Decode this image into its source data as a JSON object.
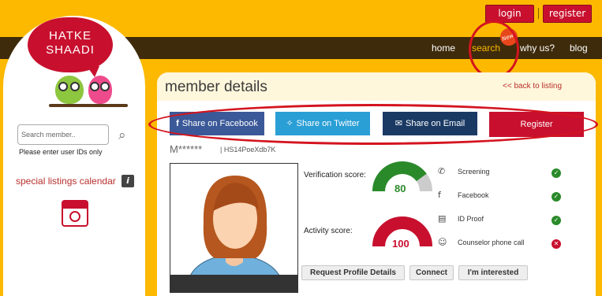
{
  "header": {
    "login": "login",
    "register": "register",
    "nav": [
      {
        "label": "home"
      },
      {
        "label": "search"
      },
      {
        "label": "why us?"
      },
      {
        "label": "blog"
      }
    ],
    "new_badge": "New!"
  },
  "logo": {
    "line1": "HATKE",
    "line2": "SHAADI"
  },
  "sidebar": {
    "search_placeholder": "Search member..",
    "hint": "Please enter user IDs only",
    "calendar_link": "special listings calendar",
    "info_glyph": "i"
  },
  "main": {
    "title": "member details",
    "back_link": "<< back to listing",
    "share": {
      "facebook": "Share on Facebook",
      "twitter": "Share on Twitter",
      "email": "Share on Email",
      "register": "Register"
    },
    "member_name": "M******",
    "member_id": "| HS14PoeXdb7K",
    "verification_label": "Verification score:",
    "verification_score": 80,
    "activity_label": "Activity score:",
    "activity_score": 100,
    "checks": [
      {
        "label": "Screening",
        "icon": "phone-icon",
        "status": "ok"
      },
      {
        "label": "Facebook",
        "icon": "facebook-icon",
        "status": "ok"
      },
      {
        "label": "ID Proof",
        "icon": "document-icon",
        "status": "ok"
      },
      {
        "label": "Counselor phone call",
        "icon": "counselor-icon",
        "status": "fail"
      }
    ],
    "actions": {
      "request": "Request Profile Details",
      "connect": "Connect",
      "interested": "I'm interested"
    }
  },
  "colors": {
    "background": "#fcb900",
    "accent": "#c8102e",
    "nav_bar": "#3e2b0b",
    "verification_gauge": "#2a8a2a",
    "activity_gauge": "#c8102e"
  }
}
